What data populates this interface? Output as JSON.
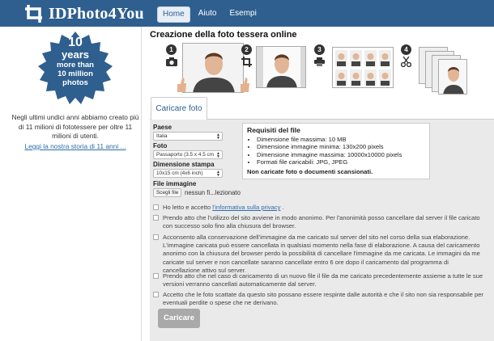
{
  "header": {
    "logo_text": "IDPhoto4You",
    "nav": [
      {
        "label": "Home",
        "active": true
      },
      {
        "label": "Aiuto",
        "active": false
      },
      {
        "label": "Esempi",
        "active": false
      }
    ]
  },
  "sidebar": {
    "badge": {
      "line1": "10",
      "line2": "years",
      "line3": "more than",
      "line4": "10 million",
      "line5": "photos",
      "color": "#2f5f8f"
    },
    "text": "Negli ultimi undici anni abbiamo creato più di 11 milioni di fototessere per oltre 11 milioni di utenti.",
    "link": "Leggi la nostra storia di 11 anni ..."
  },
  "main": {
    "title": "Creazione della foto tessera online",
    "steps": [
      "1",
      "2",
      "3",
      "4"
    ],
    "step_icons": [
      "camera-icon",
      "crop-icon",
      "printer-icon",
      "scissors-icon"
    ],
    "tab_label": "Caricare foto",
    "form": {
      "paese_label": "Paese",
      "paese_value": "Italia",
      "foto_label": "Foto",
      "foto_value": "Passaporto (3.5 x 4.5 cm",
      "dimensione_label": "Dimensione stampa",
      "dimensione_value": "10x15 cm    (4x6 inch)",
      "file_label": "File immagine",
      "file_button": "Scegli file",
      "file_name": "nessun fi...lezionato"
    },
    "requirements": {
      "title": "Requisiti del file",
      "items": [
        "Dimensione file massima: 10 MB",
        "Dimensione immagine minima: 130x200 pixels",
        "Dimensione immagine massima: 10000x10000 pixels",
        "Formati file caricabili:  JPG,  JPEG"
      ],
      "note": "Non caricate foto o documenti scansionati."
    },
    "checks": {
      "c1_pre": "Ho letto e accetto ",
      "c1_link": "l'informativa sulla privacy",
      "c1_post": " .",
      "c2": "Prendo atto che l'utilizzo del sito avviene in modo anonimo. Per l'anonimità posso cancellare dal server il file caricato con successo solo fino alla chiusura del browser.",
      "c3": "Acconsento alla conservazione dell'immagine da me caricato sul server del sito nel corso della sua elaborazione. L'immagine caricata può essere cancellata in qualsiasi momento nella fase di elaborazione. A causa del caricamento anonimo con la chiusura del browser perdo la possibilità di cancellare l'immagine da me caricata. Le immagini da me caricate sul server e non cancellate saranno cancellate entro 6 ore dopo il caricamento dal programma di cancellazione attivo sul server.",
      "c4": "Prendo atto che nel caso di caricamento di un nuovo file il file da me caricato precedentemente assieme a tutte le sue versioni verranno cancellati automaticamente dal server.",
      "c5": "Accetto che le foto scattate da questo sito possano essere respinte dalle autorità e che il sito non sia responsabile per eventuali perdite o spese che ne derivano."
    },
    "submit_label": "Caricare"
  }
}
